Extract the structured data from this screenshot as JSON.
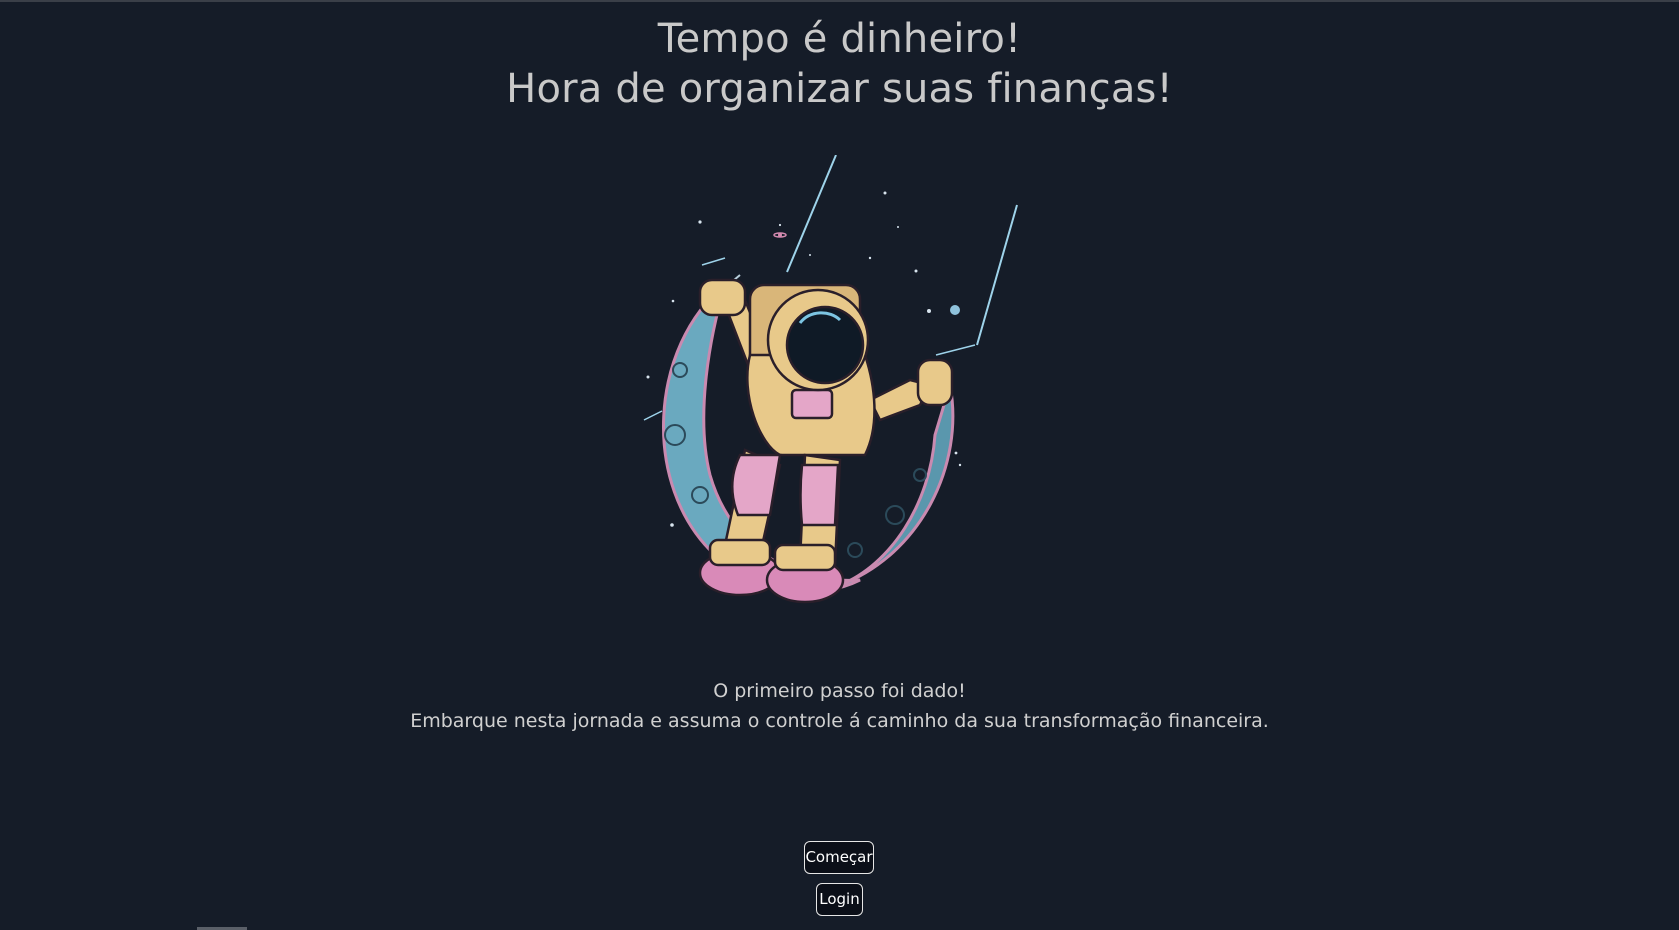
{
  "hero": {
    "title_line1": "Tempo é dinheiro!",
    "title_line2": "Hora de organizar suas finanças!"
  },
  "illustration": {
    "icon": "astronaut-on-moon-swing-illustration"
  },
  "intro": {
    "line1": "O primeiro passo foi dado!",
    "line2": "Embarque nesta jornada e assuma o controle á caminho da sua transformação financeira."
  },
  "actions": {
    "start_label": "Começar",
    "login_label": "Login"
  },
  "colors": {
    "background": "#151c28",
    "text": "#c9c9c9",
    "button_bg": "#0b0f18",
    "button_border": "#e6e6e6"
  }
}
